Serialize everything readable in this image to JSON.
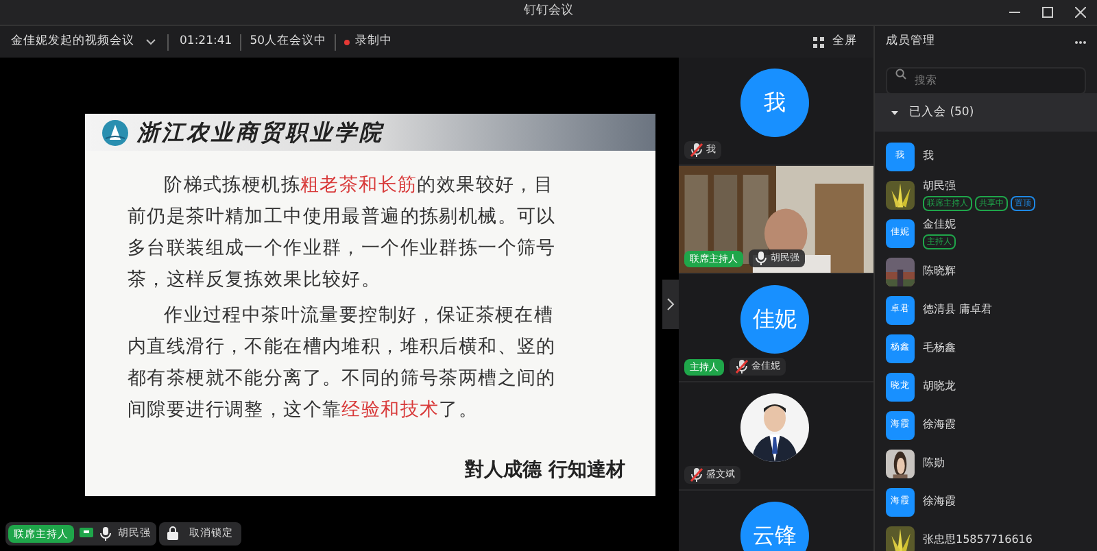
{
  "window": {
    "title": "钉钉会议"
  },
  "toolbar": {
    "meeting_title": "金佳妮发起的视频会议",
    "duration": "01:21:41",
    "count": "50人在会议中",
    "recording": "录制中",
    "fullscreen": "全屏"
  },
  "slide": {
    "school": "浙江农业商贸职业学院",
    "paragraphs": [
      [
        {
          "text": "阶梯式拣梗机拣",
          "emphasis": false
        },
        {
          "text": "粗老茶和长筋",
          "emphasis": true
        },
        {
          "text": "的效果较好，目前仍是茶叶精加工中使用最普遍的拣剔机械。可以多台联装组成一个作业群，一个作业群拣一个筛号茶，这样反复拣效果比较好。",
          "emphasis": false
        }
      ],
      [
        {
          "text": "作业过程中茶叶流量要控制好，保证茶梗在槽内直线滑行，不能在槽内堆积，堆积后横和、竖的都有茶梗就不能分离了。不同的筛号茶两槽之间的间隙要进行调整，这个靠",
          "emphasis": false
        },
        {
          "text": "经验和技术",
          "emphasis": true
        },
        {
          "text": "了。",
          "emphasis": false
        }
      ]
    ],
    "motto": "對人成德 行知達材"
  },
  "tiles": [
    {
      "kind": "avatar",
      "avatar": "我",
      "name": "我",
      "muted": true
    },
    {
      "kind": "video",
      "name": "胡民强",
      "role": "联席主持人",
      "muted": false
    },
    {
      "kind": "avatar",
      "avatar": "佳妮",
      "name": "金佳妮",
      "role": "主持人",
      "muted": true
    },
    {
      "name": "盛文斌",
      "muted": true
    },
    {
      "kind": "avatar",
      "avatar": "云锋"
    }
  ],
  "bottom_bar": {
    "role": "联席主持人",
    "speaker": "胡民强",
    "unlock": "取消锁定"
  },
  "members_panel": {
    "title": "成员管理",
    "search_placeholder": "搜索",
    "section": "已入会 (50)",
    "section_expanded": true,
    "members": [
      {
        "kind": "text",
        "avatar": "我",
        "name": "我"
      },
      {
        "name": "胡民强",
        "tags": [
          {
            "label": "联席主持人",
            "color": "#1fa64a"
          },
          {
            "label": "共享中",
            "color": "#1fa64a"
          },
          {
            "label": "置顶",
            "color": "#1e88e5"
          }
        ]
      },
      {
        "kind": "text",
        "avatar": "佳妮",
        "name": "金佳妮",
        "tags": [
          {
            "label": "主持人",
            "color": "#1fa64a"
          }
        ]
      },
      {
        "name": "陈晓辉"
      },
      {
        "kind": "text",
        "avatar": "卓君",
        "name": "德清县 庸卓君"
      },
      {
        "kind": "text",
        "avatar": "杨鑫",
        "name": "毛杨鑫"
      },
      {
        "kind": "text",
        "avatar": "晓龙",
        "name": "胡晓龙"
      },
      {
        "kind": "text",
        "avatar": "海霞",
        "name": "徐海霞"
      },
      {
        "name": "陈勋"
      },
      {
        "kind": "text",
        "avatar": "海霞",
        "name": "徐海霞"
      },
      {
        "name": "张忠思15857716616"
      }
    ]
  }
}
